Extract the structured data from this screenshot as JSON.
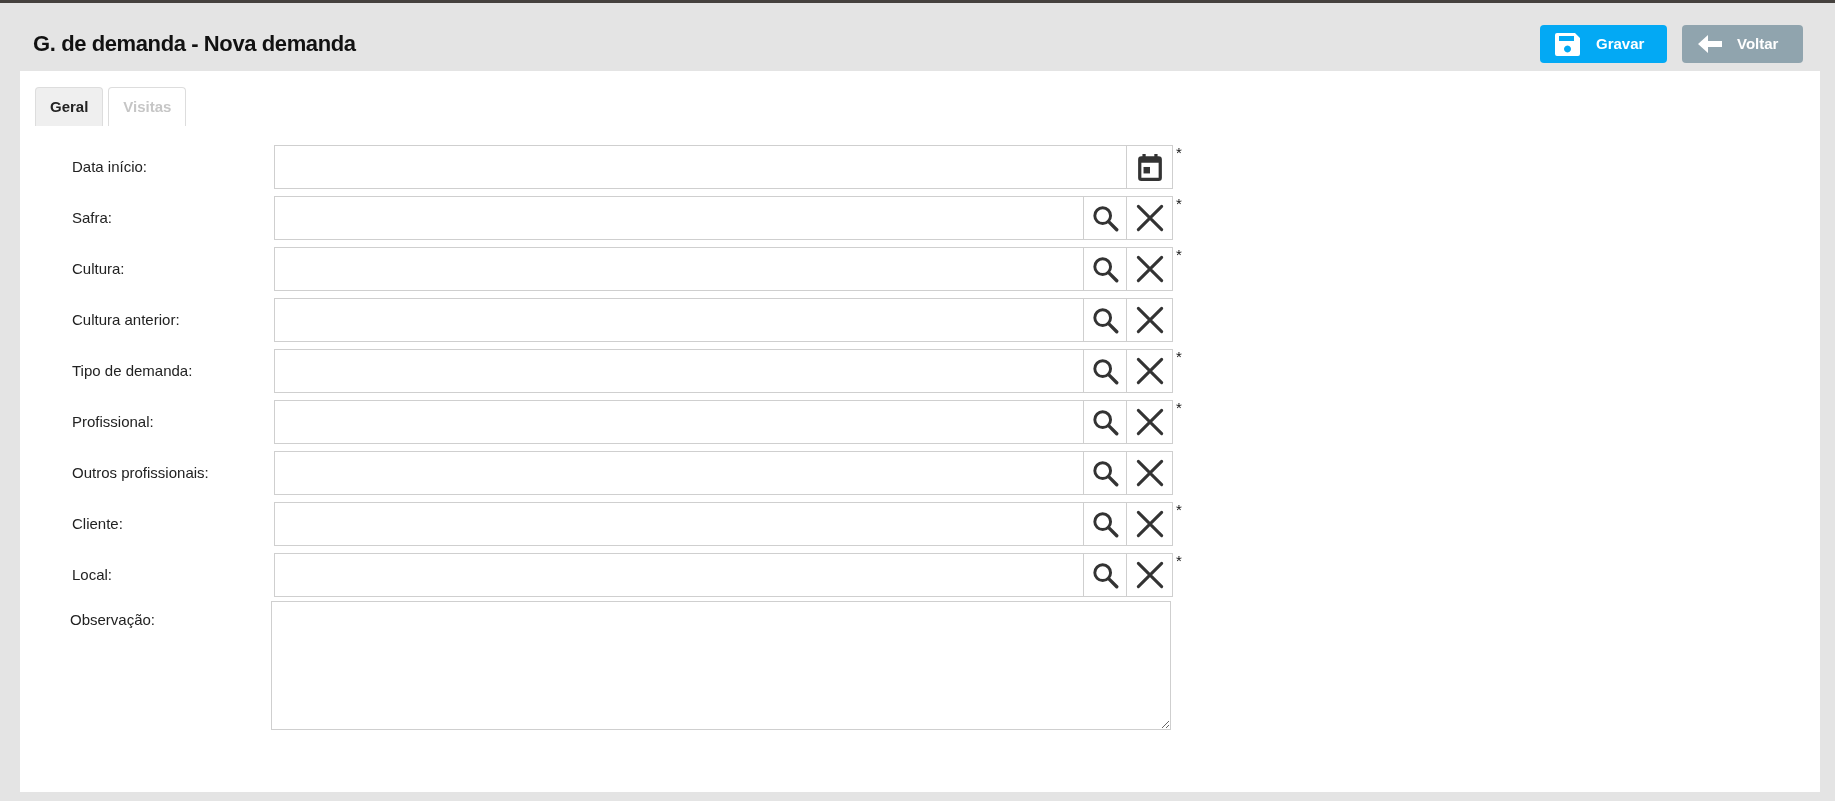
{
  "header": {
    "title": "G. de demanda - Nova demanda",
    "buttons": [
      {
        "kind": "save",
        "label": "Gravar"
      },
      {
        "kind": "back",
        "label": "Voltar"
      }
    ]
  },
  "tabs": [
    {
      "label": "Geral",
      "selected": true
    },
    {
      "label": "Visitas",
      "selected": false
    }
  ],
  "form": {
    "fields": [
      {
        "kind": "date",
        "label": "Data início:",
        "required_mark": "*"
      },
      {
        "kind": "lookup",
        "label": "Safra:",
        "required_mark": "*"
      },
      {
        "kind": "lookup",
        "label": "Cultura:",
        "required_mark": "*"
      },
      {
        "kind": "lookup",
        "label": "Cultura anterior:"
      },
      {
        "kind": "lookup",
        "label": "Tipo de demanda:",
        "required_mark": "*"
      },
      {
        "kind": "lookup",
        "label": "Profissional:",
        "required_mark": "*"
      },
      {
        "kind": "lookup",
        "label": "Outros profissionais:"
      },
      {
        "kind": "lookup",
        "label": "Cliente:",
        "required_mark": "*"
      },
      {
        "kind": "lookup",
        "label": "Local:",
        "required_mark": "*"
      }
    ],
    "notes": {
      "label": "Observação:"
    }
  }
}
